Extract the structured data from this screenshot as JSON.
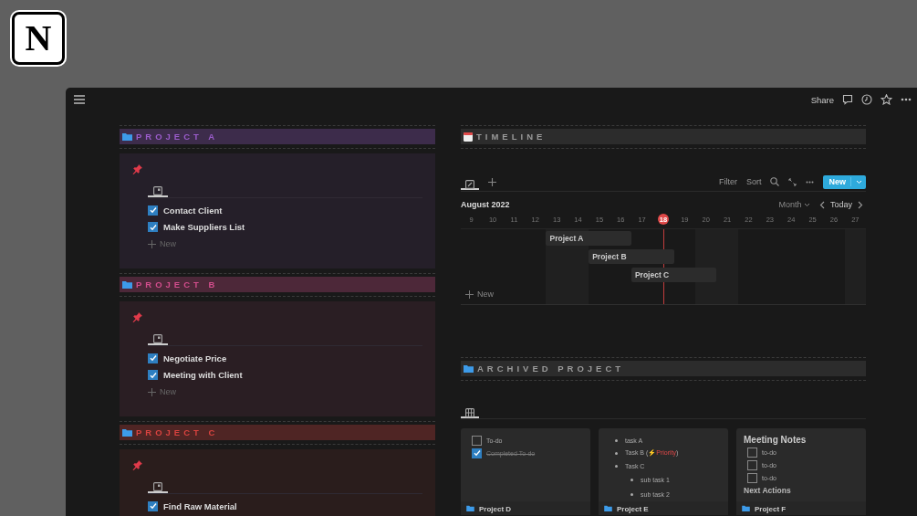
{
  "logo": {
    "letter": "N"
  },
  "topbar": {
    "share": "Share"
  },
  "projects": [
    {
      "title": "PROJECT A",
      "color": "#9b5ccb",
      "tasks": [
        {
          "text": "Contact Client",
          "checked": true
        },
        {
          "text": "Make Suppliers List",
          "checked": true
        }
      ],
      "new_label": "New"
    },
    {
      "title": "PROJECT B",
      "color": "#d24d8c",
      "tasks": [
        {
          "text": "Negotiate Price",
          "checked": true
        },
        {
          "text": "Meeting with Client",
          "checked": true
        }
      ],
      "new_label": "New"
    },
    {
      "title": "PROJECT C",
      "color": "#d9433f",
      "tasks": [
        {
          "text": "Find Raw Material",
          "checked": true
        }
      ]
    }
  ],
  "timeline": {
    "title": "TIMELINE",
    "toolbar": [
      "Filter",
      "Sort"
    ],
    "new_button": "New",
    "month": "August 2022",
    "scale": "Month",
    "today_button": "Today",
    "days": [
      {
        "label": "9",
        "weekend": false,
        "today": false
      },
      {
        "label": "10",
        "weekend": false,
        "today": false
      },
      {
        "label": "11",
        "weekend": false,
        "today": false
      },
      {
        "label": "12",
        "weekend": false,
        "today": false
      },
      {
        "label": "13",
        "weekend": true,
        "today": false
      },
      {
        "label": "14",
        "weekend": true,
        "today": false
      },
      {
        "label": "15",
        "weekend": false,
        "today": false
      },
      {
        "label": "16",
        "weekend": false,
        "today": false
      },
      {
        "label": "17",
        "weekend": false,
        "today": false
      },
      {
        "label": "18",
        "weekend": false,
        "today": true
      },
      {
        "label": "19",
        "weekend": false,
        "today": false
      },
      {
        "label": "20",
        "weekend": true,
        "today": false
      },
      {
        "label": "21",
        "weekend": true,
        "today": false
      },
      {
        "label": "22",
        "weekend": false,
        "today": false
      },
      {
        "label": "23",
        "weekend": false,
        "today": false
      },
      {
        "label": "24",
        "weekend": false,
        "today": false
      },
      {
        "label": "25",
        "weekend": false,
        "today": false
      },
      {
        "label": "26",
        "weekend": false,
        "today": false
      },
      {
        "label": "27",
        "weekend": true,
        "today": false
      }
    ],
    "items": [
      {
        "label": "Project A"
      },
      {
        "label": "Project B"
      },
      {
        "label": "Project C"
      }
    ],
    "new_label": "New"
  },
  "archived": {
    "title": "ARCHIVED PROJECT",
    "cards": [
      {
        "kind": "todo",
        "items": [
          {
            "text": "To-do",
            "checked": false
          },
          {
            "text": "Completed To-do",
            "checked": true
          }
        ],
        "footer": "Project D"
      },
      {
        "kind": "bullets",
        "bullets": [
          {
            "text": "task A"
          },
          {
            "text": "Task B (",
            "icon": "⚡",
            "highlight": "Priority",
            "after": ")"
          },
          {
            "text": "Task C",
            "children": [
              {
                "text": "sub task 1"
              },
              {
                "text": "sub task 2"
              }
            ]
          }
        ],
        "footer": "Project E"
      },
      {
        "kind": "notes",
        "heading": "Meeting Notes",
        "items": [
          {
            "text": "to-do",
            "checked": false
          },
          {
            "text": "to-do",
            "checked": false
          },
          {
            "text": "to-do",
            "checked": false
          }
        ],
        "subheading": "Next Actions",
        "footer": "Project F"
      }
    ]
  }
}
